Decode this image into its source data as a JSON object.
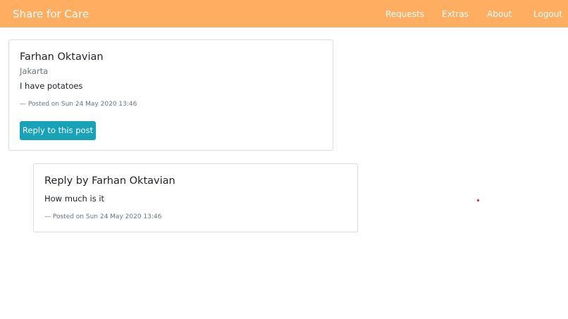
{
  "navbar": {
    "brand": "Share for Care",
    "links": {
      "requests": "Requests",
      "extras": "Extras",
      "about": "About",
      "logout": "Logout"
    },
    "background_color": "#ffad60"
  },
  "post": {
    "author": "Farhan Oktavian",
    "location": "Jakarta",
    "text": "I have potatoes",
    "meta": "— Posted on Sun 24 May 2020 13:46",
    "reply_button_label": "Reply to this post",
    "reply_button_color": "#17a2b8"
  },
  "reply": {
    "title": "Reply by Farhan Oktavian",
    "text": "How much is it",
    "meta": "— Posted on Sun 24 May 2020 13:46"
  }
}
